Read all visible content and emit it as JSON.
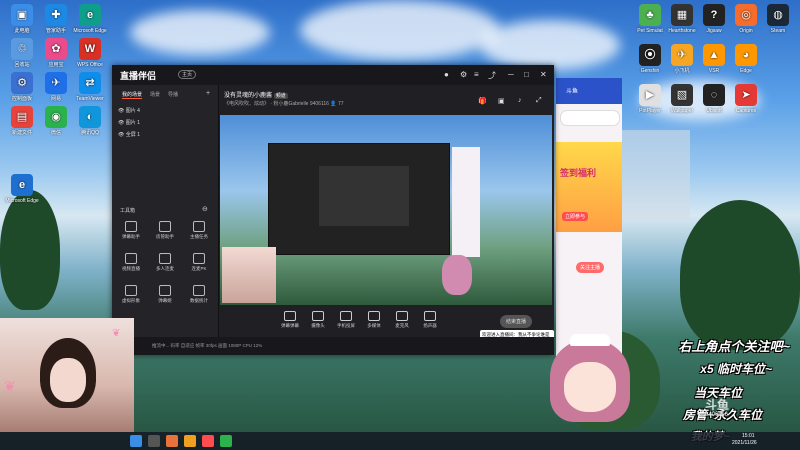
{
  "desktop": {
    "left_icons": [
      {
        "label": "此电脑",
        "color": "#3b8ee8",
        "glyph": "▣",
        "col": 0,
        "row": 0
      },
      {
        "label": "管家助手",
        "color": "#1e88e5",
        "glyph": "✚",
        "col": 1,
        "row": 0
      },
      {
        "label": "Microsoft Edge",
        "color": "#0f9d8c",
        "glyph": "e",
        "col": 2,
        "row": 0
      },
      {
        "label": "回收站",
        "color": "#5a9be0",
        "glyph": "♲",
        "col": 0,
        "row": 1
      },
      {
        "label": "应用宝",
        "color": "#e94b8b",
        "glyph": "✿",
        "col": 1,
        "row": 1
      },
      {
        "label": "WPS Office",
        "color": "#d93025",
        "glyph": "W",
        "col": 2,
        "row": 1
      },
      {
        "label": "控制面板",
        "color": "#3b6fd0",
        "glyph": "⚙",
        "col": 0,
        "row": 2
      },
      {
        "label": "网易",
        "color": "#1f6fe8",
        "glyph": "✈",
        "col": 1,
        "row": 2
      },
      {
        "label": "TeamViewer",
        "color": "#0e8ee9",
        "glyph": "⇄",
        "col": 2,
        "row": 2
      },
      {
        "label": "新建文件",
        "color": "#e8433a",
        "glyph": "▤",
        "col": 0,
        "row": 3
      },
      {
        "label": "微信",
        "color": "#2bb24c",
        "glyph": "◉",
        "col": 1,
        "row": 3
      },
      {
        "label": "腾讯QQ",
        "color": "#1296db",
        "glyph": "◐",
        "col": 2,
        "row": 3
      },
      {
        "label": "Microsoft Edge",
        "color": "#1e6fd0",
        "glyph": "e",
        "col": 0,
        "row": 5
      }
    ],
    "right_icons": [
      {
        "label": "Pet Simulat",
        "color": "#4caf50",
        "glyph": "♣",
        "col": 0,
        "row": 0
      },
      {
        "label": "Hearthstone",
        "color": "#333",
        "glyph": "▦",
        "col": 1,
        "row": 0
      },
      {
        "label": "Jigsaw",
        "color": "#222",
        "glyph": "?",
        "col": 2,
        "row": 0
      },
      {
        "label": "Origin",
        "color": "#f56c2d",
        "glyph": "◎",
        "col": 3,
        "row": 0
      },
      {
        "label": "Steam",
        "color": "#1b2838",
        "glyph": "◍",
        "col": 4,
        "row": 0
      },
      {
        "label": "Genshin",
        "color": "#222",
        "glyph": "⦿",
        "col": 0,
        "row": 1
      },
      {
        "label": "小飞机",
        "color": "#f6a623",
        "glyph": "✈",
        "col": 1,
        "row": 1
      },
      {
        "label": "VSR",
        "color": "#ff9800",
        "glyph": "▲",
        "col": 2,
        "row": 1
      },
      {
        "label": "Edge",
        "color": "#ff9800",
        "glyph": "◕",
        "col": 3,
        "row": 1
      },
      {
        "label": "PotPlayer",
        "color": "#e0e0e0",
        "glyph": "▶",
        "col": 0,
        "row": 2
      },
      {
        "label": "Wallpaper",
        "color": "#333",
        "glyph": "▧",
        "col": 1,
        "row": 2
      },
      {
        "label": "Ubisoft",
        "color": "#222",
        "glyph": "◌",
        "col": 2,
        "row": 2
      },
      {
        "label": "Captures",
        "color": "#e53935",
        "glyph": "➤",
        "col": 3,
        "row": 2
      }
    ]
  },
  "app": {
    "logo": "直播伴侣",
    "badge": "主页",
    "left_tabs": [
      {
        "label": "我的场景",
        "active": true
      },
      {
        "label": "场景",
        "active": false
      },
      {
        "label": "导播",
        "active": false
      }
    ],
    "scenes": [
      "图片 4",
      "图片 1",
      "全屏 1"
    ],
    "tools_title": "工具箱",
    "tools": [
      {
        "label": "弹幕助手"
      },
      {
        "label": "房管助手"
      },
      {
        "label": "主播任务"
      },
      {
        "label": "视频直播"
      },
      {
        "label": "多人连麦"
      },
      {
        "label": "连麦PK"
      },
      {
        "label": "虚拟形象"
      },
      {
        "label": "弹幕姬"
      },
      {
        "label": "数据统计"
      }
    ],
    "room_title": "没有灵魂的小鹿酱",
    "room_tag": "频道",
    "room_sub": "《电风吹吹、炫动》  ·  粉小鹿Gabrielle  9406116",
    "viewers": "77",
    "bottom_tools": [
      {
        "label": "弹幕弹幕"
      },
      {
        "label": "摄像头"
      },
      {
        "label": "手机投屏"
      },
      {
        "label": "多媒体"
      },
      {
        "label": "麦克风"
      },
      {
        "label": "扬声器"
      }
    ],
    "go_live": "结束直播",
    "status_text": "推流中...  码率 自适应  帧率 30fps  画面 1080P  CPU 12%",
    "chat_popup": "欢迎进入直播间：我从不争论谁是谁的粉丝"
  },
  "browser": {
    "tab_label": "斗鱼",
    "banner_text": "签到福利",
    "banner_sub": "立即参与",
    "follow_btn": "关注主播"
  },
  "overlay": {
    "lines": [
      "右上角点个关注吧~",
      "x5 临时车位~",
      "当天车位",
      "房管+永久车位",
      "我的梦~"
    ],
    "watermark_logo": "斗鱼",
    "room_number": "9406116",
    "clock_time": "15:01",
    "clock_date": "2021/11/26"
  }
}
